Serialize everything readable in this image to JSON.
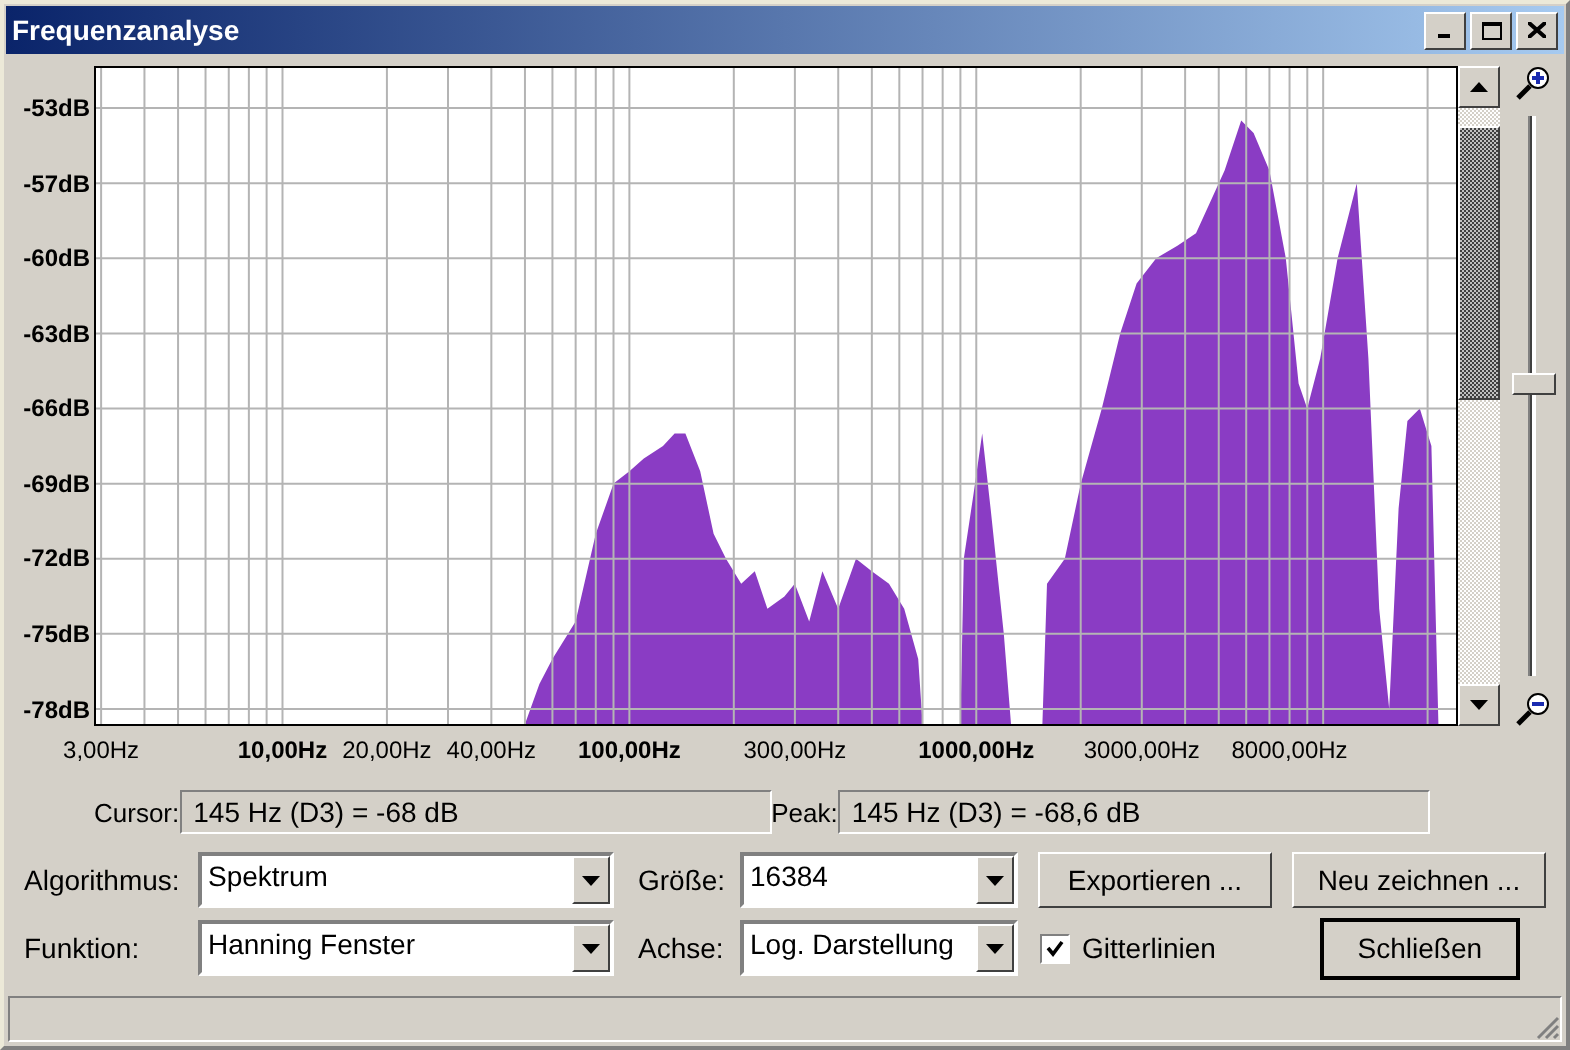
{
  "window": {
    "title": "Frequenzanalyse"
  },
  "plot": {
    "y_labels": [
      "-53dB",
      "-57dB",
      "-60dB",
      "-63dB",
      "-66dB",
      "-69dB",
      "-72dB",
      "-75dB",
      "-78dB"
    ],
    "x_labels": [
      {
        "label": "3,00Hz",
        "bold": false
      },
      {
        "label": "10,00Hz",
        "bold": true
      },
      {
        "label": "20,00Hz",
        "bold": false
      },
      {
        "label": "40,00Hz",
        "bold": false
      },
      {
        "label": "100,00Hz",
        "bold": true
      },
      {
        "label": "300,00Hz",
        "bold": false
      },
      {
        "label": "1000,00Hz",
        "bold": true
      },
      {
        "label": "3000,00Hz",
        "bold": false
      },
      {
        "label": "8000,00Hz",
        "bold": false
      }
    ]
  },
  "zoom_slider": {
    "level": 0.52
  },
  "cursor": {
    "label": "Cursor:",
    "value": "145 Hz (D3) = -68 dB"
  },
  "peak": {
    "label": "Peak:",
    "value": "145 Hz (D3) = -68,6 dB"
  },
  "algorithm": {
    "label": "Algorithmus:",
    "value": "Spektrum"
  },
  "size": {
    "label": "Größe:",
    "value": "16384"
  },
  "function": {
    "label": "Funktion:",
    "value": "Hanning Fenster"
  },
  "axis": {
    "label": "Achse:",
    "value": "Log. Darstellung"
  },
  "export_button": {
    "label": "Exportieren ..."
  },
  "redraw_button": {
    "label": "Neu zeichnen ..."
  },
  "gridlines": {
    "label": "Gitterlinien",
    "checked": true
  },
  "close_button": {
    "label": "Schließen"
  }
}
